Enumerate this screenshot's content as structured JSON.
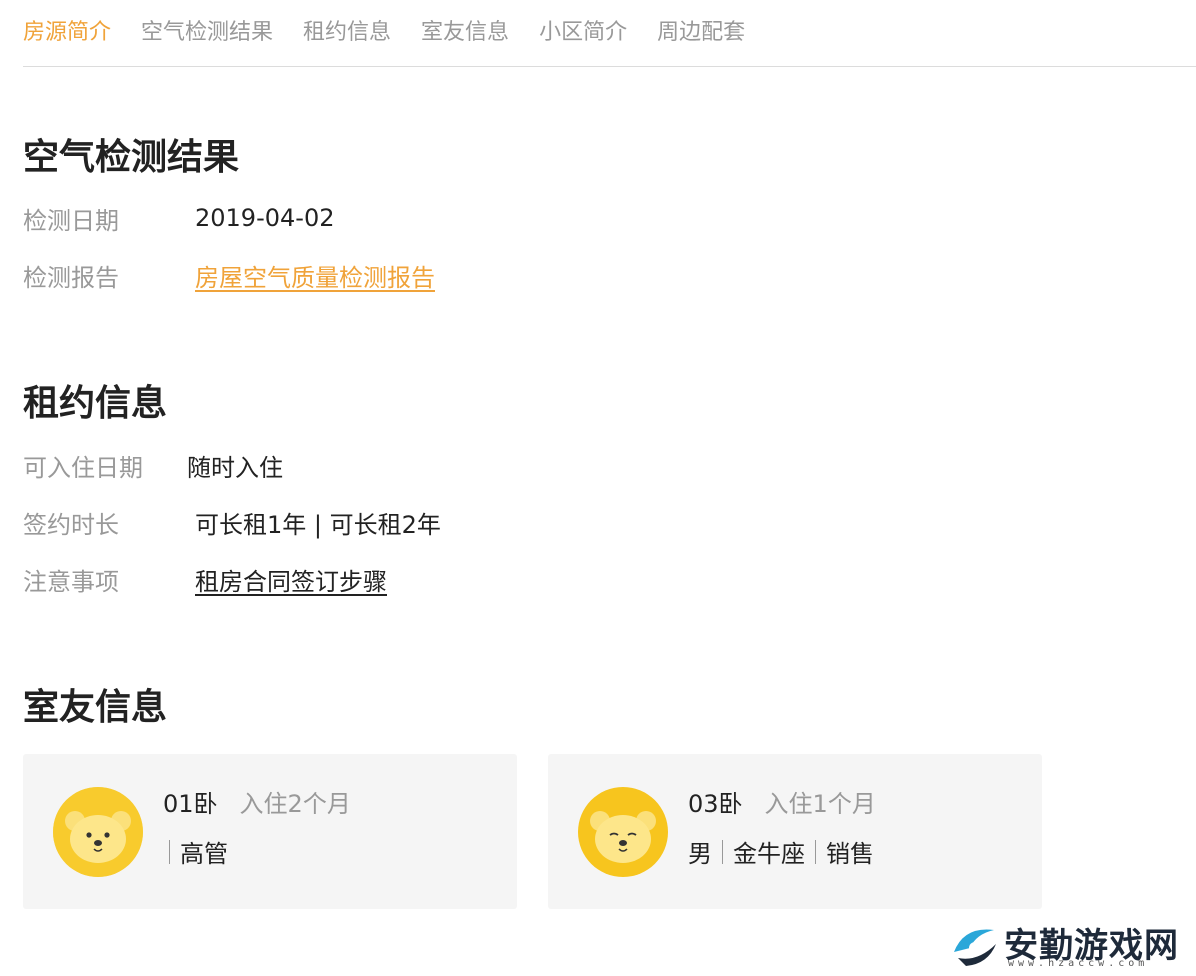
{
  "tabs": [
    {
      "label": "房源简介",
      "active": true
    },
    {
      "label": "空气检测结果",
      "active": false
    },
    {
      "label": "租约信息",
      "active": false
    },
    {
      "label": "室友信息",
      "active": false
    },
    {
      "label": "小区简介",
      "active": false
    },
    {
      "label": "周边配套",
      "active": false
    }
  ],
  "air": {
    "title": "空气检测结果",
    "date_label": "检测日期",
    "date_value": "2019-04-02",
    "report_label": "检测报告",
    "report_link": "房屋空气质量检测报告"
  },
  "lease": {
    "title": "租约信息",
    "movein_label": "可入住日期",
    "movein_value": "随时入住",
    "term_label": "签约时长",
    "term_value": "可长租1年 | 可长租2年",
    "notes_label": "注意事项",
    "notes_link": "租房合同签订步骤"
  },
  "roommates": {
    "title": "室友信息",
    "cards": [
      {
        "room": "01卧",
        "stay": "入住2个月",
        "tags": [
          "",
          "高管"
        ]
      },
      {
        "room": "03卧",
        "stay": "入住1个月",
        "tags": [
          "男",
          "金牛座",
          "销售"
        ]
      }
    ]
  },
  "watermark": {
    "text": "安勤游戏网",
    "url": "www.hzaccw.com"
  },
  "colors": {
    "accent": "#f0a33a",
    "muted": "#999999",
    "text": "#222222",
    "card_bg": "#f5f5f5",
    "avatar": "#f7c51e"
  }
}
